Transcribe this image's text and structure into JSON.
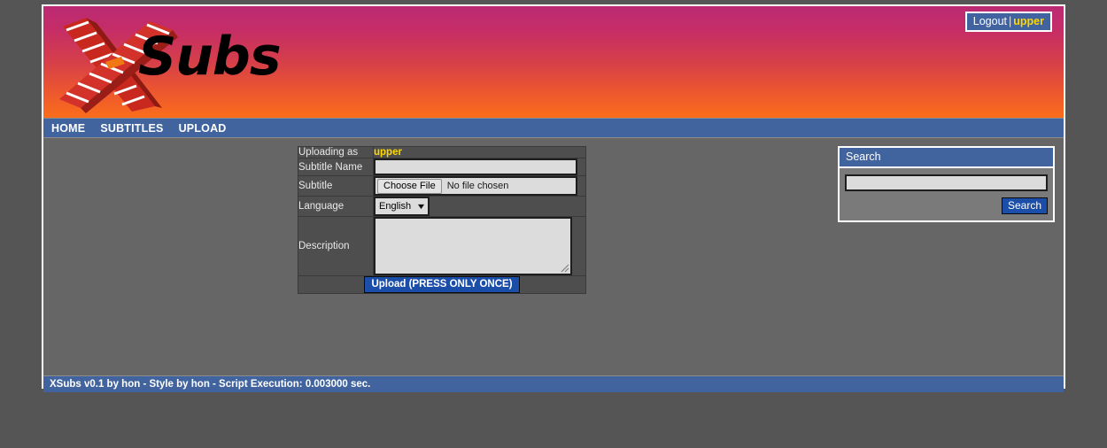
{
  "header": {
    "logo_letter": "X",
    "logo_word": "Subs",
    "user_box": {
      "logout_label": "Logout",
      "separator": "|",
      "username": "upper"
    }
  },
  "nav": {
    "items": [
      {
        "label": "HOME"
      },
      {
        "label": "SUBTITLES"
      },
      {
        "label": "UPLOAD"
      }
    ]
  },
  "upload_form": {
    "rows": {
      "uploading_as": {
        "label": "Uploading as",
        "value": "upper"
      },
      "subtitle_name": {
        "label": "Subtitle Name",
        "value": "",
        "placeholder": ""
      },
      "subtitle_file": {
        "label": "Subtitle",
        "choose_button": "Choose File",
        "file_status": "No file chosen"
      },
      "language": {
        "label": "Language",
        "selected": "English",
        "options": [
          "English"
        ]
      },
      "description": {
        "label": "Description",
        "value": "",
        "placeholder": ""
      }
    },
    "submit_label": "Upload (PRESS ONLY ONCE)"
  },
  "search_panel": {
    "title": "Search",
    "input_value": "",
    "input_placeholder": "",
    "button_label": "Search"
  },
  "footer": {
    "text": "XSubs v0.1 by hon - Style by hon - Script Execution: 0.003000 sec."
  },
  "colors": {
    "nav_blue": "#41649f",
    "button_blue": "#1b4ea8",
    "username_gold": "#ffd700",
    "banner_gradient_top": "#bb2a74",
    "banner_gradient_bottom": "#fa6d1b",
    "page_background": "#666666",
    "outer_background": "#555555"
  }
}
